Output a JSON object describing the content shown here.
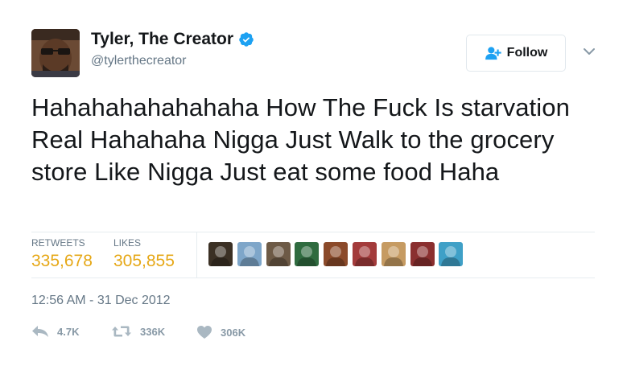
{
  "author": {
    "display_name": "Tyler, The Creator",
    "handle": "@tylerthecreator",
    "verified": true
  },
  "follow_button": {
    "label": "Follow",
    "icon": "add-user-icon"
  },
  "tweet": {
    "text": "Hahahahahahahaha How The Fuck Is starvation Real Hahahaha Nigga Just Walk to the grocery store Like Nigga Just eat some food Haha"
  },
  "stats": {
    "retweets_label": "RETWEETS",
    "retweets_value": "335,678",
    "likes_label": "LIKES",
    "likes_value": "305,855"
  },
  "likers": [
    {
      "icon": "liker-avatar",
      "color": "#3b3024"
    },
    {
      "icon": "liker-avatar",
      "color": "#7ea6c9"
    },
    {
      "icon": "liker-avatar",
      "color": "#6d5a46"
    },
    {
      "icon": "liker-avatar",
      "color": "#2f6b3f"
    },
    {
      "icon": "liker-avatar",
      "color": "#8b4a2a"
    },
    {
      "icon": "liker-avatar",
      "color": "#a33b3b"
    },
    {
      "icon": "liker-avatar",
      "color": "#c69b62"
    },
    {
      "icon": "liker-avatar",
      "color": "#8a2f2f"
    },
    {
      "icon": "liker-avatar",
      "color": "#3fa0c7"
    }
  ],
  "timestamp": "12:56 AM - 31 Dec 2012",
  "actions": {
    "reply_count": "4.7K",
    "retweet_count": "336K",
    "like_count": "306K"
  },
  "colors": {
    "stat_value": "#e6a817",
    "verified_blue": "#1da1f2",
    "muted": "#657786",
    "action_gray": "#8899a6"
  }
}
